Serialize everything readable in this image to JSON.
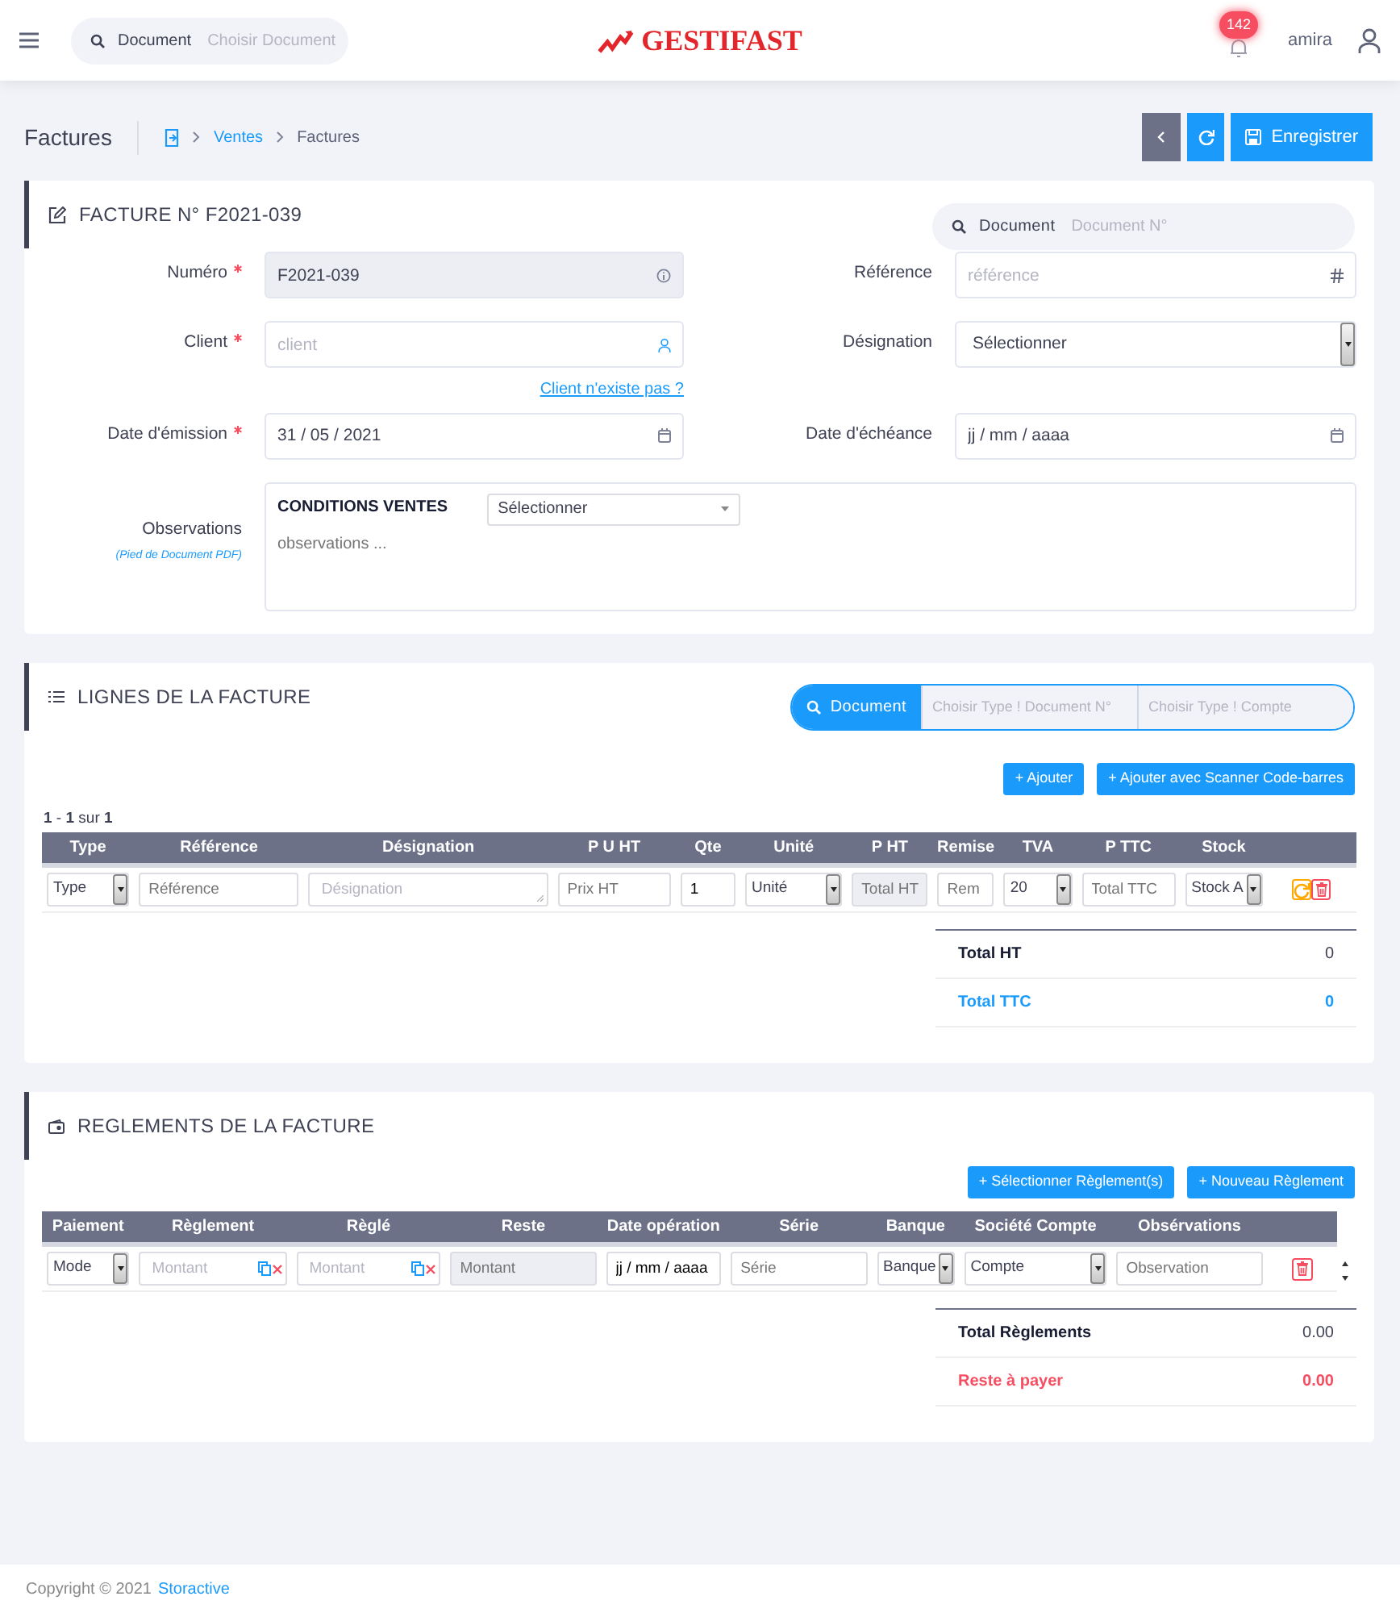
{
  "topbar": {
    "search": {
      "label": "Document",
      "placeholder": "Choisir Document"
    },
    "logo": "GESTIFAST",
    "notifications": "142",
    "user": "amira"
  },
  "subheader": {
    "title": "Factures",
    "breadcrumb": [
      "Ventes",
      "Factures"
    ],
    "buttons": [
      {
        "kind": "back"
      },
      {
        "kind": "refresh"
      },
      {
        "kind": "save",
        "label": "Enregistrer"
      }
    ]
  },
  "invoice": {
    "title": "FACTURE N° F2021-039",
    "doc_search": {
      "label": "Document",
      "placeholder": "Document N°"
    },
    "fields": [
      {
        "label": "Numéro",
        "required": true,
        "kind": "readonly",
        "value": "F2021-039",
        "disabled": true
      },
      {
        "label": "Référence",
        "required": false,
        "kind": "tag",
        "placeholder": "référence",
        "disabled": false
      },
      {
        "label": "Client",
        "required": true,
        "kind": "person",
        "placeholder": "client",
        "link": "Client n'existe pas ?",
        "disabled": false
      },
      {
        "label": "Désignation",
        "required": false,
        "kind": "select",
        "value": "Sélectionner",
        "disabled": false
      },
      {
        "label": "Date d'émission",
        "required": true,
        "kind": "date",
        "value": "31 / 05 / 2021",
        "disabled": false
      },
      {
        "label": "Date d'échéance",
        "required": false,
        "kind": "date",
        "value": "jj / mm / aaaa",
        "disabled": false
      }
    ],
    "observations": {
      "label": "Observations",
      "note": "(Pied de Document PDF)",
      "conditions": "CONDITIONS VENTES",
      "select": "Sélectionner",
      "placeholder": "observations ..."
    }
  },
  "lines": {
    "title": "LIGNES DE LA FACTURE",
    "search": {
      "label": "Document",
      "placeholders": [
        "Choisir Type ! Document N°",
        "Choisir Type ! Compte"
      ]
    },
    "buttons": [
      "+ Ajouter",
      "+ Ajouter avec Scanner Code-barres"
    ],
    "pagination": "**1** - **1** sur **1**",
    "columns": [
      "Type",
      "Référence",
      "Désignation",
      "P U HT",
      "Qte",
      "Unité",
      "P HT",
      "Remise",
      "TVA",
      "P TTC",
      "Stock",
      ""
    ],
    "row": [
      {
        "kind": "select",
        "value": "Type"
      },
      {
        "kind": "input",
        "placeholder": "Référence"
      },
      {
        "kind": "textarea",
        "placeholder": "Désignation"
      },
      {
        "kind": "input",
        "placeholder": "Prix HT"
      },
      {
        "kind": "input",
        "value": "1"
      },
      {
        "kind": "select",
        "value": "Unité"
      },
      {
        "kind": "disabled",
        "placeholder": "Total HT"
      },
      {
        "kind": "input",
        "placeholder": "Rem"
      },
      {
        "kind": "select",
        "value": "20"
      },
      {
        "kind": "input",
        "placeholder": "Total TTC"
      },
      {
        "kind": "select",
        "value": "Stock A"
      },
      {
        "kind": "actions"
      }
    ],
    "totals": [
      {
        "label": "Total HT",
        "value": "0",
        "kind": "normal"
      },
      {
        "label": "Total TTC",
        "value": "0",
        "kind": "highlight"
      }
    ]
  },
  "payments": {
    "title": "REGLEMENTS DE LA FACTURE",
    "buttons": [
      "+ Sélectionner Règlement(s)",
      "+ Nouveau Règlement"
    ],
    "columns": [
      "Paiement",
      "Règlement",
      "Règlé",
      "Reste",
      "Date opération",
      "Série",
      "Banque",
      "Société Compte",
      "Obsérvations",
      ""
    ],
    "row": [
      {
        "kind": "select",
        "value": "Mode"
      },
      {
        "kind": "amount",
        "placeholder": "Montant"
      },
      {
        "kind": "amount",
        "placeholder": "Montant"
      },
      {
        "kind": "disabled",
        "placeholder": "Montant"
      },
      {
        "kind": "input",
        "value": "jj / mm / aaaa"
      },
      {
        "kind": "input",
        "placeholder": "Série"
      },
      {
        "kind": "select",
        "value": "Banque"
      },
      {
        "kind": "select",
        "value": "Compte"
      },
      {
        "kind": "input",
        "placeholder": "Observation"
      },
      {
        "kind": "delete"
      }
    ],
    "totals": [
      {
        "label": "Total Règlements",
        "value": "0.00",
        "kind": "normal"
      },
      {
        "label": "Reste à payer",
        "value": "0.00",
        "kind": "alert"
      }
    ]
  },
  "footer": {
    "text": "Copyright © 2021",
    "link": "Storactive"
  }
}
